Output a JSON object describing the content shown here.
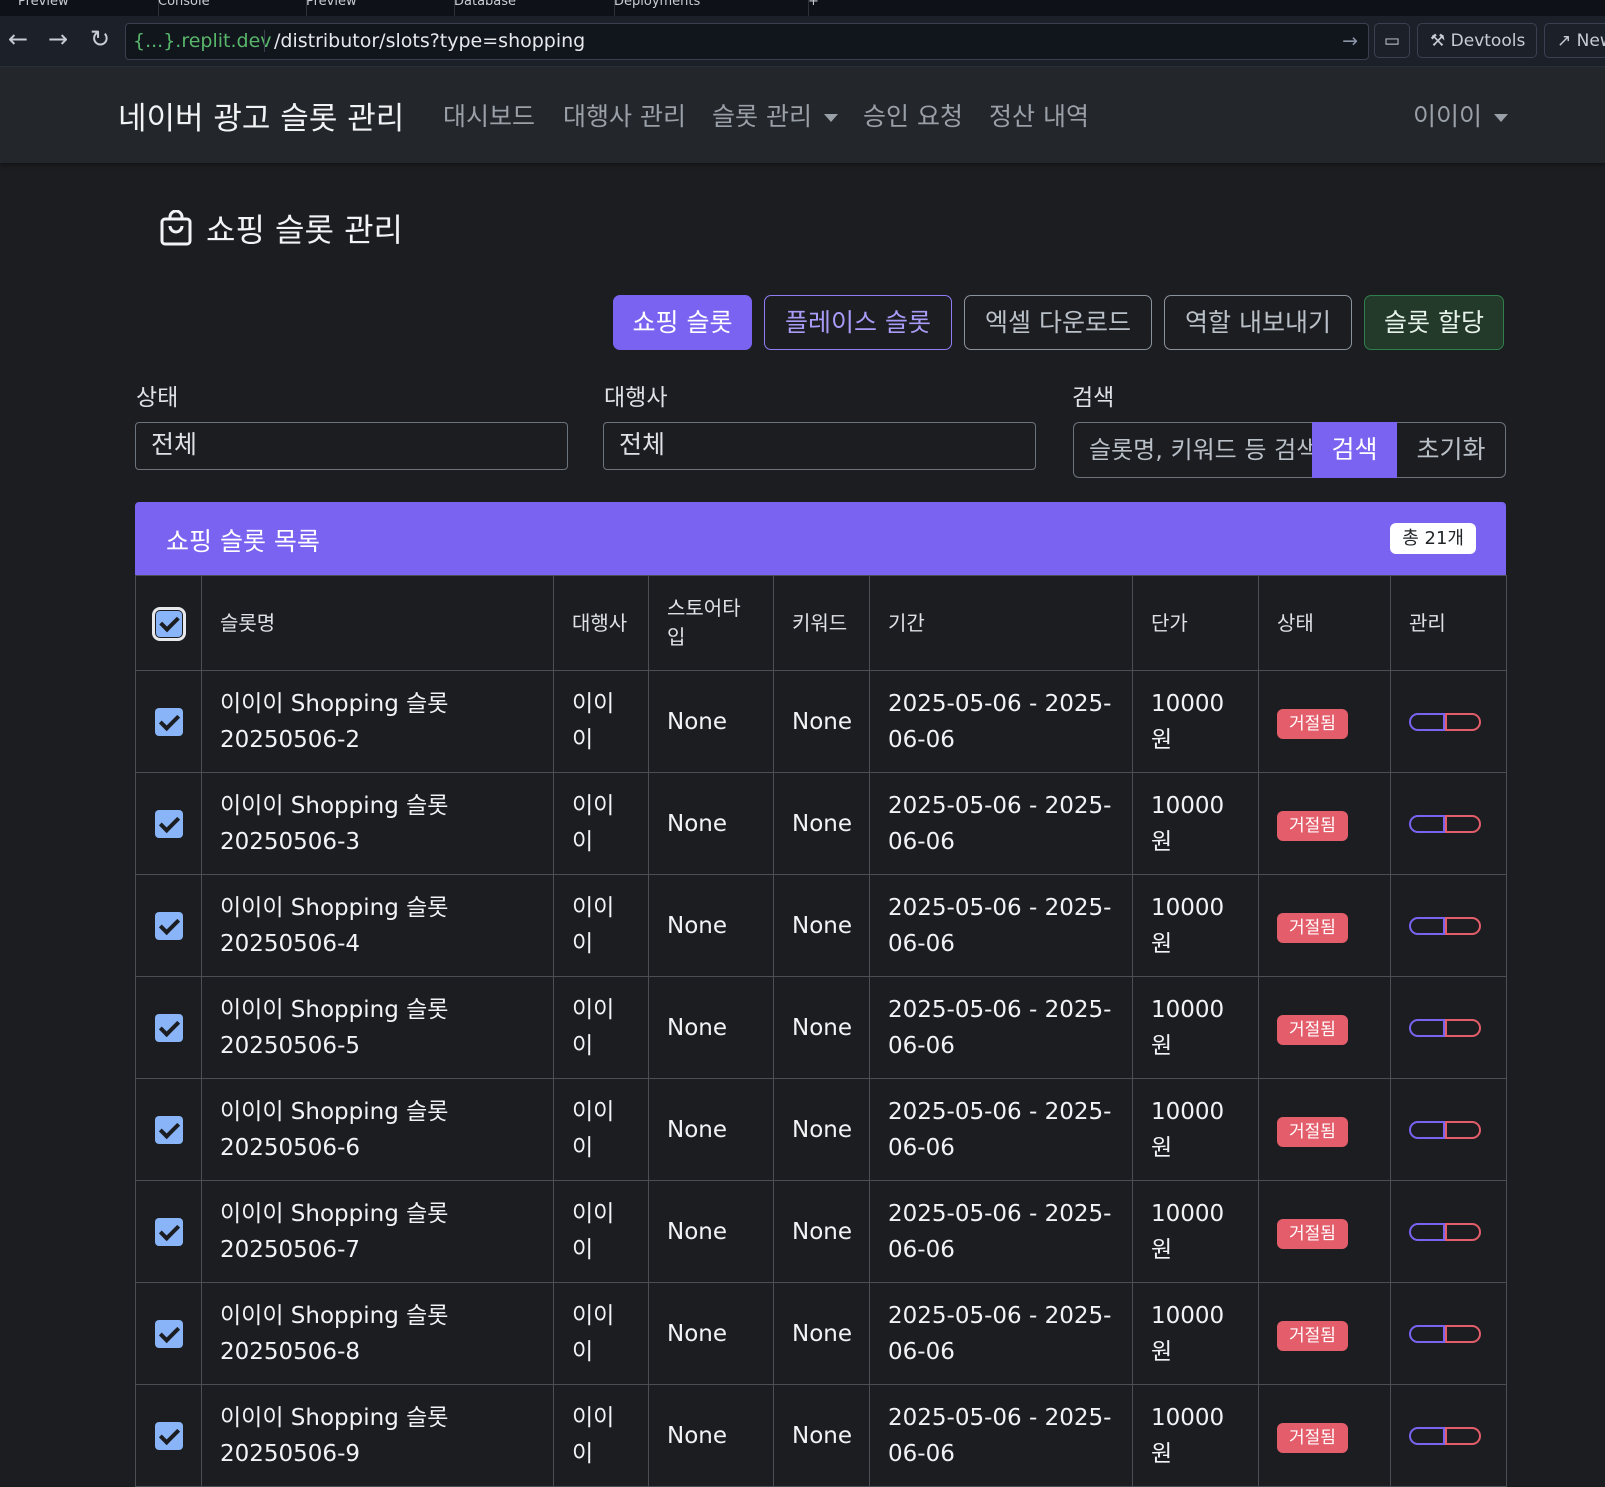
{
  "browser": {
    "tabs": [
      "Preview",
      "Console",
      "Preview",
      "Database",
      "Deployments",
      "+"
    ],
    "url_host": "{...}.replit.dev",
    "url_path": "/distributor/slots?type=shopping",
    "devtools_label": "Devtools",
    "new_tab_label": "New tab"
  },
  "navbar": {
    "brand": "네이버 광고 슬롯 관리",
    "links": [
      "대시보드",
      "대행사 관리",
      "슬롯 관리",
      "승인 요청",
      "정산 내역"
    ],
    "user": "이이이"
  },
  "page": {
    "title": "쇼핑 슬롯 관리"
  },
  "actions": {
    "shopping": "쇼핑 슬롯",
    "place": "플레이스 슬롯",
    "excel": "엑셀 다운로드",
    "export_role": "역할 내보내기",
    "assign": "슬롯 할당"
  },
  "filters": {
    "status_label": "상태",
    "status_value": "전체",
    "agency_label": "대행사",
    "agency_value": "전체",
    "search_label": "검색",
    "search_placeholder": "슬롯명, 키워드 등 검색",
    "search_button": "검색",
    "reset_button": "초기화"
  },
  "list": {
    "title": "쇼핑 슬롯 목록",
    "count": "총 21개",
    "headers": [
      "슬롯명",
      "대행사",
      "스토어타입",
      "키워드",
      "기간",
      "단가",
      "상태",
      "관리"
    ],
    "rows": [
      {
        "name": "이이이 Shopping 슬롯 20250506-2",
        "agency": "이이이",
        "store_type": "None",
        "keyword": "None",
        "period": "2025-05-06 - 2025-06-06",
        "price": "10000원",
        "status": "거절됨"
      },
      {
        "name": "이이이 Shopping 슬롯 20250506-3",
        "agency": "이이이",
        "store_type": "None",
        "keyword": "None",
        "period": "2025-05-06 - 2025-06-06",
        "price": "10000원",
        "status": "거절됨"
      },
      {
        "name": "이이이 Shopping 슬롯 20250506-4",
        "agency": "이이이",
        "store_type": "None",
        "keyword": "None",
        "period": "2025-05-06 - 2025-06-06",
        "price": "10000원",
        "status": "거절됨"
      },
      {
        "name": "이이이 Shopping 슬롯 20250506-5",
        "agency": "이이이",
        "store_type": "None",
        "keyword": "None",
        "period": "2025-05-06 - 2025-06-06",
        "price": "10000원",
        "status": "거절됨"
      },
      {
        "name": "이이이 Shopping 슬롯 20250506-6",
        "agency": "이이이",
        "store_type": "None",
        "keyword": "None",
        "period": "2025-05-06 - 2025-06-06",
        "price": "10000원",
        "status": "거절됨"
      },
      {
        "name": "이이이 Shopping 슬롯 20250506-7",
        "agency": "이이이",
        "store_type": "None",
        "keyword": "None",
        "period": "2025-05-06 - 2025-06-06",
        "price": "10000원",
        "status": "거절됨"
      },
      {
        "name": "이이이 Shopping 슬롯 20250506-8",
        "agency": "이이이",
        "store_type": "None",
        "keyword": "None",
        "period": "2025-05-06 - 2025-06-06",
        "price": "10000원",
        "status": "거절됨"
      },
      {
        "name": "이이이 Shopping 슬롯 20250506-9",
        "agency": "이이이",
        "store_type": "None",
        "keyword": "None",
        "period": "2025-05-06 - 2025-06-06",
        "price": "10000원",
        "status": "거절됨"
      }
    ]
  },
  "colors": {
    "primary": "#7b63f2",
    "danger": "#e35d6a",
    "success_border": "#2f7f4a",
    "background": "#1b1d21",
    "navbar": "#23262b"
  }
}
